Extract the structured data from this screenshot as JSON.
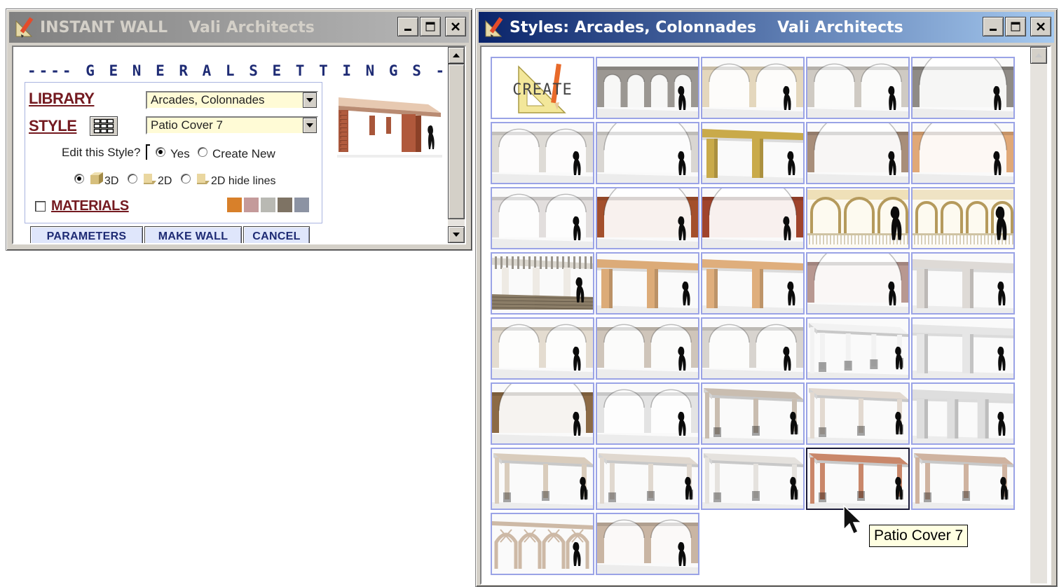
{
  "left_window": {
    "title": "INSTANT WALL",
    "subtitle": "Vali Architects",
    "heading": "---- G E N E R A L   S E T T I N G S -----",
    "library_label": "LIBRARY",
    "library_value": "Arcades, Colonnades",
    "style_label": "STYLE",
    "style_value": "Patio Cover 7",
    "edit_style_label": "Edit this Style?",
    "edit_yes": "Yes",
    "edit_create_new": "Create New",
    "view_3d": "3D",
    "view_2d": "2D",
    "view_2d_hide": "2D hide lines",
    "materials_label": "MATERIALS",
    "materials_checked": false,
    "swatches": [
      "#d8802a",
      "#c49a9a",
      "#b9b9b3",
      "#7e7364",
      "#8c93a3"
    ],
    "btn_parameters": "PARAMETERS",
    "btn_make_wall": "MAKE WALL",
    "btn_cancel": "CANCEL"
  },
  "right_window": {
    "title": "Styles: Arcades, Colonnades",
    "subtitle": "Vali Architects",
    "create_label": "CREATE",
    "tooltip": "Patio Cover 7",
    "selected_index": 33,
    "styles": [
      {
        "kind": "create"
      },
      {
        "kind": "arches",
        "color": "#9b9792",
        "n": 4
      },
      {
        "kind": "arches",
        "color": "#e4d7bd",
        "n": 2
      },
      {
        "kind": "arches",
        "color": "#cfcac3",
        "n": 2
      },
      {
        "kind": "arches",
        "color": "#8f8b86",
        "n": 1
      },
      {
        "kind": "arches",
        "color": "#dedbd6",
        "n": 2
      },
      {
        "kind": "arches",
        "color": "#d9d6d2",
        "n": 1
      },
      {
        "kind": "posts",
        "color": "#c9aa4a",
        "n": 2
      },
      {
        "kind": "arches",
        "color": "#a88e7a",
        "n": 1
      },
      {
        "kind": "arches",
        "color": "#e0a877",
        "n": 1
      },
      {
        "kind": "arches",
        "color": "#e2dedd",
        "n": 2
      },
      {
        "kind": "arches",
        "color": "#a4502c",
        "n": 1
      },
      {
        "kind": "arches",
        "color": "#a0442c",
        "n": 1
      },
      {
        "kind": "colonnade",
        "color": "#efe0b8",
        "n": 3
      },
      {
        "kind": "colonnade",
        "color": "#efe3c4",
        "n": 4
      },
      {
        "kind": "pergola",
        "color": "#dcd8d0",
        "n": 3
      },
      {
        "kind": "posts",
        "color": "#dcab78",
        "n": 2
      },
      {
        "kind": "posts",
        "color": "#dfae7c",
        "n": 2
      },
      {
        "kind": "arches",
        "color": "#b89891",
        "n": 1
      },
      {
        "kind": "posts",
        "color": "#dedad6",
        "n": 2
      },
      {
        "kind": "arches",
        "color": "#e4dcd0",
        "n": 2
      },
      {
        "kind": "arches",
        "color": "#cfc5ba",
        "n": 2
      },
      {
        "kind": "arches",
        "color": "#d8d4cf",
        "n": 2
      },
      {
        "kind": "patio",
        "color": "#f2f2f2",
        "n": 4
      },
      {
        "kind": "posts",
        "color": "#e6e6e6",
        "n": 2
      },
      {
        "kind": "arches",
        "color": "#8c6a45",
        "n": 1
      },
      {
        "kind": "arches",
        "color": "#e3e3e3",
        "n": 2
      },
      {
        "kind": "patio",
        "color": "#c9bdb0",
        "n": 3
      },
      {
        "kind": "patio",
        "color": "#e2d9d0",
        "n": 3
      },
      {
        "kind": "posts",
        "color": "#dedede",
        "n": 3
      },
      {
        "kind": "patio",
        "color": "#d9ccbc",
        "n": 3
      },
      {
        "kind": "patio",
        "color": "#e0d8cf",
        "n": 3
      },
      {
        "kind": "patio",
        "color": "#e5e2de",
        "n": 3
      },
      {
        "kind": "patio",
        "color": "#c9876a",
        "n": 3
      },
      {
        "kind": "patio",
        "color": "#cfb3a0",
        "n": 3
      },
      {
        "kind": "gothic",
        "color": "#cdb9a6",
        "n": 3
      },
      {
        "kind": "arches",
        "color": "#c9b5a3",
        "n": 2
      }
    ]
  }
}
